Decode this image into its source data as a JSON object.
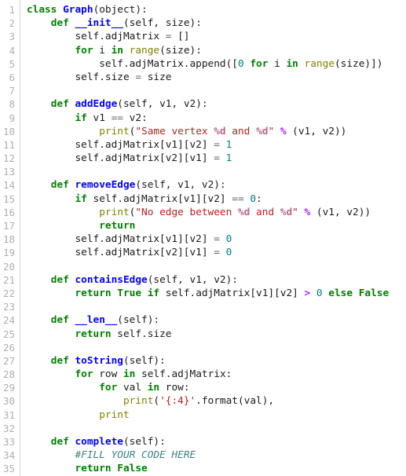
{
  "editor": {
    "language": "Python",
    "background_color": "#ffffff",
    "gutter_separator_color": "#d2d2d2",
    "line_number_color": "#afafaf",
    "first_line_number": 1,
    "last_visible_line_number": 36,
    "total_rendered_lines": 35
  },
  "theme": {
    "keyword": "#008000",
    "class_name": "#0000ff",
    "function_name": "#0000ff",
    "builtin": "#808000",
    "string": "#ba2121",
    "string_interp": "#bb6688",
    "number": "#008080",
    "constant": "#008000",
    "operator": "#aa22ff",
    "comment": "#408080",
    "text": "#1a1a1a"
  },
  "line_numbers": [
    "1",
    "2",
    "3",
    "4",
    "5",
    "6",
    "7",
    "8",
    "9",
    "10",
    "11",
    "12",
    "13",
    "14",
    "15",
    "16",
    "17",
    "18",
    "19",
    "20",
    "21",
    "22",
    "23",
    "24",
    "25",
    "26",
    "27",
    "28",
    "29",
    "30",
    "31",
    "32",
    "33",
    "34",
    "35"
  ],
  "code": {
    "plain_text": "class Graph(object):\n    def __init__(self, size):\n        self.adjMatrix = []\n        for i in range(size):\n            self.adjMatrix.append([0 for i in range(size)])\n        self.size = size\n\n    def addEdge(self, v1, v2):\n        if v1 == v2:\n            print(\"Same vertex %d and %d\" % (v1, v2))\n        self.adjMatrix[v1][v2] = 1\n        self.adjMatrix[v2][v1] = 1\n\n    def removeEdge(self, v1, v2):\n        if self.adjMatrix[v1][v2] == 0:\n            print(\"No edge between %d and %d\" % (v1, v2))\n            return\n        self.adjMatrix[v1][v2] = 0\n        self.adjMatrix[v2][v1] = 0\n\n    def containsEdge(self, v1, v2):\n        return True if self.adjMatrix[v1][v2] > 0 else False\n\n    def __len__(self):\n        return self.size\n\n    def toString(self):\n        for row in self.adjMatrix:\n            for val in row:\n                print('{:4}'.format(val),\n            print\n\n    def complete(self):\n        #FILL YOUR CODE HERE\n        return False",
    "lines": [
      {
        "n": 1,
        "tokens": [
          {
            "t": "class",
            "c": "k"
          },
          {
            "t": " ",
            "c": "p"
          },
          {
            "t": "Graph",
            "c": "nc"
          },
          {
            "t": "(object):",
            "c": "p"
          }
        ]
      },
      {
        "n": 2,
        "tokens": [
          {
            "t": "    ",
            "c": "p"
          },
          {
            "t": "def",
            "c": "k"
          },
          {
            "t": " ",
            "c": "p"
          },
          {
            "t": "__init__",
            "c": "fm"
          },
          {
            "t": "(self, size):",
            "c": "p"
          }
        ]
      },
      {
        "n": 3,
        "tokens": [
          {
            "t": "        self.adjMatrix ",
            "c": "p"
          },
          {
            "t": "=",
            "c": "o"
          },
          {
            "t": " []",
            "c": "p"
          }
        ]
      },
      {
        "n": 4,
        "tokens": [
          {
            "t": "        ",
            "c": "p"
          },
          {
            "t": "for",
            "c": "k"
          },
          {
            "t": " i ",
            "c": "p"
          },
          {
            "t": "in",
            "c": "k"
          },
          {
            "t": " ",
            "c": "p"
          },
          {
            "t": "range",
            "c": "nb"
          },
          {
            "t": "(size):",
            "c": "p"
          }
        ]
      },
      {
        "n": 5,
        "tokens": [
          {
            "t": "            self.adjMatrix.append([",
            "c": "p"
          },
          {
            "t": "0",
            "c": "m"
          },
          {
            "t": " ",
            "c": "p"
          },
          {
            "t": "for",
            "c": "k"
          },
          {
            "t": " i ",
            "c": "p"
          },
          {
            "t": "in",
            "c": "k"
          },
          {
            "t": " ",
            "c": "p"
          },
          {
            "t": "range",
            "c": "nb"
          },
          {
            "t": "(size)])",
            "c": "p"
          }
        ]
      },
      {
        "n": 6,
        "tokens": [
          {
            "t": "        self.size ",
            "c": "p"
          },
          {
            "t": "=",
            "c": "o"
          },
          {
            "t": " size",
            "c": "p"
          }
        ]
      },
      {
        "n": 7,
        "tokens": []
      },
      {
        "n": 8,
        "tokens": [
          {
            "t": "    ",
            "c": "p"
          },
          {
            "t": "def",
            "c": "k"
          },
          {
            "t": " ",
            "c": "p"
          },
          {
            "t": "addEdge",
            "c": "nf"
          },
          {
            "t": "(self, v1, v2):",
            "c": "p"
          }
        ]
      },
      {
        "n": 9,
        "tokens": [
          {
            "t": "        ",
            "c": "p"
          },
          {
            "t": "if",
            "c": "k"
          },
          {
            "t": " v1 ",
            "c": "p"
          },
          {
            "t": "==",
            "c": "o"
          },
          {
            "t": " v2:",
            "c": "p"
          }
        ]
      },
      {
        "n": 10,
        "tokens": [
          {
            "t": "            ",
            "c": "p"
          },
          {
            "t": "print",
            "c": "nb"
          },
          {
            "t": "(",
            "c": "p"
          },
          {
            "t": "\"Same vertex ",
            "c": "s"
          },
          {
            "t": "%d",
            "c": "si"
          },
          {
            "t": " and ",
            "c": "s"
          },
          {
            "t": "%d",
            "c": "si"
          },
          {
            "t": "\"",
            "c": "s"
          },
          {
            "t": " ",
            "c": "p"
          },
          {
            "t": "%",
            "c": "op"
          },
          {
            "t": " (v1, v2))",
            "c": "p"
          }
        ]
      },
      {
        "n": 11,
        "tokens": [
          {
            "t": "        self.adjMatrix[v1][v2] ",
            "c": "p"
          },
          {
            "t": "=",
            "c": "o"
          },
          {
            "t": " ",
            "c": "p"
          },
          {
            "t": "1",
            "c": "m"
          }
        ]
      },
      {
        "n": 12,
        "tokens": [
          {
            "t": "        self.adjMatrix[v2][v1] ",
            "c": "p"
          },
          {
            "t": "=",
            "c": "o"
          },
          {
            "t": " ",
            "c": "p"
          },
          {
            "t": "1",
            "c": "m"
          }
        ]
      },
      {
        "n": 13,
        "tokens": []
      },
      {
        "n": 14,
        "tokens": [
          {
            "t": "    ",
            "c": "p"
          },
          {
            "t": "def",
            "c": "k"
          },
          {
            "t": " ",
            "c": "p"
          },
          {
            "t": "removeEdge",
            "c": "nf"
          },
          {
            "t": "(self, v1, v2):",
            "c": "p"
          }
        ]
      },
      {
        "n": 15,
        "tokens": [
          {
            "t": "        ",
            "c": "p"
          },
          {
            "t": "if",
            "c": "k"
          },
          {
            "t": " self.adjMatrix[v1][v2] ",
            "c": "p"
          },
          {
            "t": "==",
            "c": "o"
          },
          {
            "t": " ",
            "c": "p"
          },
          {
            "t": "0",
            "c": "m"
          },
          {
            "t": ":",
            "c": "p"
          }
        ]
      },
      {
        "n": 16,
        "tokens": [
          {
            "t": "            ",
            "c": "p"
          },
          {
            "t": "print",
            "c": "nb"
          },
          {
            "t": "(",
            "c": "p"
          },
          {
            "t": "\"No edge between ",
            "c": "s"
          },
          {
            "t": "%d",
            "c": "si"
          },
          {
            "t": " and ",
            "c": "s"
          },
          {
            "t": "%d",
            "c": "si"
          },
          {
            "t": "\"",
            "c": "s"
          },
          {
            "t": " ",
            "c": "p"
          },
          {
            "t": "%",
            "c": "op"
          },
          {
            "t": " (v1, v2))",
            "c": "p"
          }
        ]
      },
      {
        "n": 17,
        "tokens": [
          {
            "t": "            ",
            "c": "p"
          },
          {
            "t": "return",
            "c": "k"
          }
        ]
      },
      {
        "n": 18,
        "tokens": [
          {
            "t": "        self.adjMatrix[v1][v2] ",
            "c": "p"
          },
          {
            "t": "=",
            "c": "o"
          },
          {
            "t": " ",
            "c": "p"
          },
          {
            "t": "0",
            "c": "m"
          }
        ]
      },
      {
        "n": 19,
        "tokens": [
          {
            "t": "        self.adjMatrix[v2][v1] ",
            "c": "p"
          },
          {
            "t": "=",
            "c": "o"
          },
          {
            "t": " ",
            "c": "p"
          },
          {
            "t": "0",
            "c": "m"
          }
        ]
      },
      {
        "n": 20,
        "tokens": []
      },
      {
        "n": 21,
        "tokens": [
          {
            "t": "    ",
            "c": "p"
          },
          {
            "t": "def",
            "c": "k"
          },
          {
            "t": " ",
            "c": "p"
          },
          {
            "t": "containsEdge",
            "c": "nf"
          },
          {
            "t": "(self, v1, v2):",
            "c": "p"
          }
        ]
      },
      {
        "n": 22,
        "tokens": [
          {
            "t": "        ",
            "c": "p"
          },
          {
            "t": "return",
            "c": "k"
          },
          {
            "t": " ",
            "c": "p"
          },
          {
            "t": "True",
            "c": "kc"
          },
          {
            "t": " ",
            "c": "p"
          },
          {
            "t": "if",
            "c": "k"
          },
          {
            "t": " self.adjMatrix[v1][v2] ",
            "c": "p"
          },
          {
            "t": ">",
            "c": "op"
          },
          {
            "t": " ",
            "c": "p"
          },
          {
            "t": "0",
            "c": "m"
          },
          {
            "t": " ",
            "c": "p"
          },
          {
            "t": "else",
            "c": "k"
          },
          {
            "t": " ",
            "c": "p"
          },
          {
            "t": "False",
            "c": "kc"
          }
        ]
      },
      {
        "n": 23,
        "tokens": []
      },
      {
        "n": 24,
        "tokens": [
          {
            "t": "    ",
            "c": "p"
          },
          {
            "t": "def",
            "c": "k"
          },
          {
            "t": " ",
            "c": "p"
          },
          {
            "t": "__len__",
            "c": "fm"
          },
          {
            "t": "(self):",
            "c": "p"
          }
        ]
      },
      {
        "n": 25,
        "tokens": [
          {
            "t": "        ",
            "c": "p"
          },
          {
            "t": "return",
            "c": "k"
          },
          {
            "t": " self.size",
            "c": "p"
          }
        ]
      },
      {
        "n": 26,
        "tokens": []
      },
      {
        "n": 27,
        "tokens": [
          {
            "t": "    ",
            "c": "p"
          },
          {
            "t": "def",
            "c": "k"
          },
          {
            "t": " ",
            "c": "p"
          },
          {
            "t": "toString",
            "c": "nf"
          },
          {
            "t": "(self):",
            "c": "p"
          }
        ]
      },
      {
        "n": 28,
        "tokens": [
          {
            "t": "        ",
            "c": "p"
          },
          {
            "t": "for",
            "c": "k"
          },
          {
            "t": " row ",
            "c": "p"
          },
          {
            "t": "in",
            "c": "k"
          },
          {
            "t": " self.adjMatrix:",
            "c": "p"
          }
        ]
      },
      {
        "n": 29,
        "tokens": [
          {
            "t": "            ",
            "c": "p"
          },
          {
            "t": "for",
            "c": "k"
          },
          {
            "t": " val ",
            "c": "p"
          },
          {
            "t": "in",
            "c": "k"
          },
          {
            "t": " row:",
            "c": "p"
          }
        ]
      },
      {
        "n": 30,
        "tokens": [
          {
            "t": "                ",
            "c": "p"
          },
          {
            "t": "print",
            "c": "nb"
          },
          {
            "t": "(",
            "c": "p"
          },
          {
            "t": "'{:4}'",
            "c": "s"
          },
          {
            "t": ".format(val),",
            "c": "p"
          }
        ]
      },
      {
        "n": 31,
        "tokens": [
          {
            "t": "            ",
            "c": "p"
          },
          {
            "t": "print",
            "c": "nb"
          }
        ]
      },
      {
        "n": 32,
        "tokens": []
      },
      {
        "n": 33,
        "tokens": [
          {
            "t": "    ",
            "c": "p"
          },
          {
            "t": "def",
            "c": "k"
          },
          {
            "t": " ",
            "c": "p"
          },
          {
            "t": "complete",
            "c": "nf"
          },
          {
            "t": "(self):",
            "c": "p"
          }
        ]
      },
      {
        "n": 34,
        "tokens": [
          {
            "t": "        ",
            "c": "p"
          },
          {
            "t": "#FILL YOUR CODE HERE",
            "c": "c"
          }
        ]
      },
      {
        "n": 35,
        "tokens": [
          {
            "t": "        ",
            "c": "p"
          },
          {
            "t": "return",
            "c": "k"
          },
          {
            "t": " ",
            "c": "p"
          },
          {
            "t": "False",
            "c": "kc"
          }
        ]
      }
    ]
  }
}
